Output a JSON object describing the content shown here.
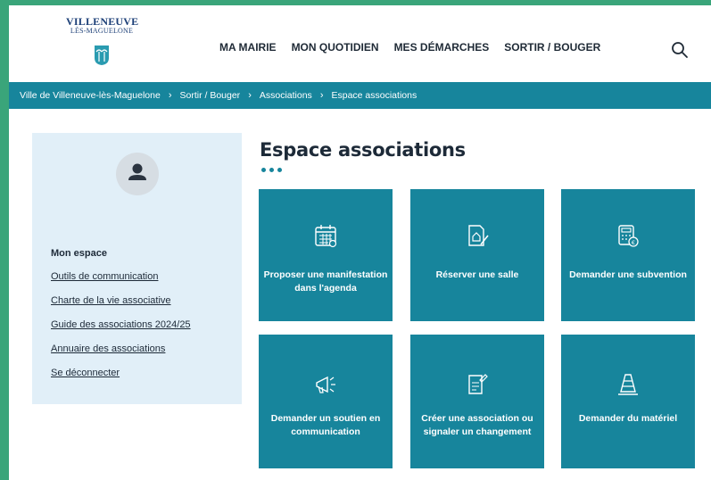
{
  "logo": {
    "line1": "VILLENEUVE",
    "line2": "LÈS-MAGUELONE"
  },
  "nav": [
    "MA MAIRIE",
    "MON QUOTIDIEN",
    "MES DÉMARCHES",
    "SORTIR / BOUGER"
  ],
  "breadcrumb": [
    "Ville de Villeneuve-lès-Maguelone",
    "Sortir / Bouger",
    "Associations",
    "Espace associations"
  ],
  "sidebar": {
    "title": "Mon espace",
    "links": [
      "Outils de communication",
      "Charte de la vie associative",
      "Guide des associations 2024/25",
      "Annuaire des associations",
      "Se déconnecter"
    ]
  },
  "main": {
    "title": "Espace associations",
    "tiles": [
      {
        "label": "Proposer une manifestation dans l'agenda",
        "icon": "calendar-icon"
      },
      {
        "label": "Réserver une salle",
        "icon": "document-pen-icon"
      },
      {
        "label": "Demander une subvention",
        "icon": "calculator-euro-icon"
      },
      {
        "label": "Demander un soutien en communication",
        "icon": "megaphone-icon"
      },
      {
        "label": "Créer une association ou signaler un changement",
        "icon": "form-edit-icon"
      },
      {
        "label": "Demander du matériel",
        "icon": "traffic-cone-icon"
      }
    ]
  },
  "colors": {
    "accent": "#17859c",
    "sidebar_bg": "#e1eff8",
    "frame": "#3aa57a"
  }
}
